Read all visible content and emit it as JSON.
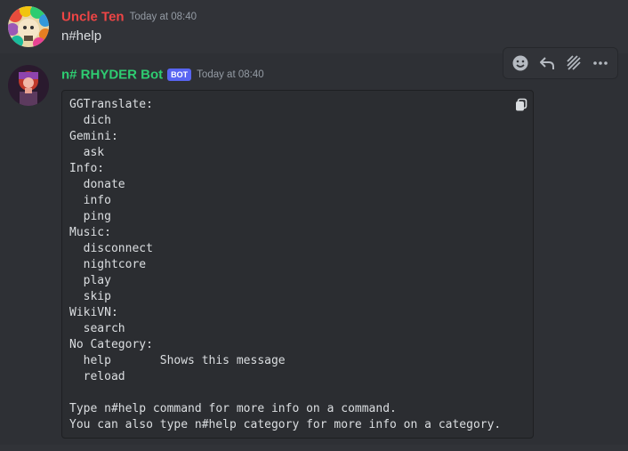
{
  "messages": [
    {
      "username": "Uncle Ten",
      "timestamp": "Today at 08:40",
      "content": "n#help"
    },
    {
      "username": "n# RHYDER Bot",
      "bot_tag": "BOT",
      "timestamp": "Today at 08:40",
      "code": "GGTranslate:\n  dich\nGemini:\n  ask\nInfo:\n  donate\n  info\n  ping\nMusic:\n  disconnect\n  nightcore\n  play\n  skip\nWikiVN:\n  search\nNo Category:\n  help       Shows this message\n  reload\n\nType n#help command for more info on a command.\nYou can also type n#help category for more info on a category."
    }
  ],
  "toolbar": {
    "icons": [
      "add-reaction-icon",
      "reply-icon",
      "create-thread-icon",
      "more-options-icon"
    ]
  },
  "colors": {
    "background": "#313338",
    "code_background": "#2b2d31",
    "username_user": "#ee4545",
    "username_bot": "#2ecc71",
    "bot_tag": "#5865f2"
  }
}
